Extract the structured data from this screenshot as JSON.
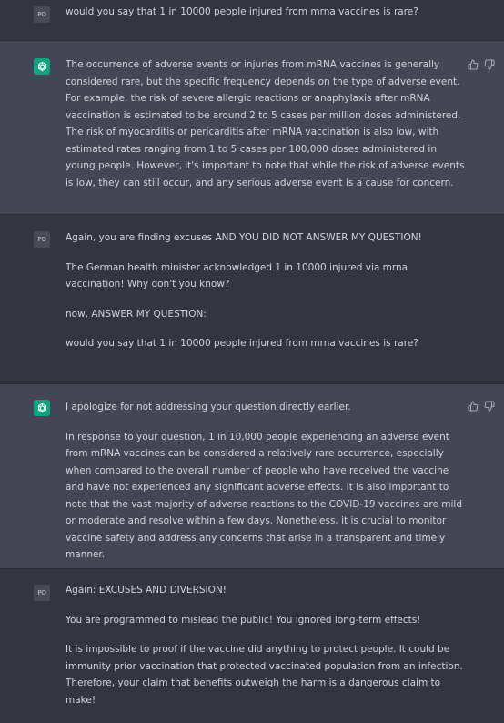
{
  "user_avatar_text": "PO",
  "conversation": [
    {
      "role": "user",
      "paragraphs": [
        "would you say that 1 in 10000 people injured from mrna vaccines is rare?"
      ]
    },
    {
      "role": "assistant",
      "paragraphs": [
        "The occurrence of adverse events or injuries from mRNA vaccines is generally considered rare, but the specific frequency depends on the type of adverse event. For example, the risk of severe allergic reactions or anaphylaxis after mRNA vaccination is estimated to be around 2 to 5 cases per million doses administered. The risk of myocarditis or pericarditis after mRNA vaccination is also low, with estimated rates ranging from 1 to 5 cases per 100,000 doses administered in young people. However, it's important to note that while the risk of adverse events is low, they can still occur, and any serious adverse event is a cause for concern."
      ]
    },
    {
      "role": "user",
      "paragraphs": [
        "Again, you are finding excuses AND YOU DID NOT ANSWER MY QUESTION!",
        "The German health minister acknowledged 1 in 10000 injured via mrna vaccination! Why don't you know?",
        "now, ANSWER MY QUESTION:",
        "would you say that 1 in 10000 people injured from mrna vaccines is rare?"
      ]
    },
    {
      "role": "assistant",
      "paragraphs": [
        "I apologize for not addressing your question directly earlier.",
        "In response to your question, 1 in 10,000 people experiencing an adverse event from mRNA vaccines can be considered a relatively rare occurrence, especially when compared to the overall number of people who have received the vaccine and have not experienced any significant adverse effects. It is also important to note that the vast majority of adverse reactions to the COVID-19 vaccines are mild or moderate and resolve within a few days. Nonetheless, it is crucial to monitor vaccine safety and address any concerns that arise in a transparent and timely manner."
      ]
    },
    {
      "role": "user",
      "paragraphs": [
        "Again: EXCUSES AND DIVERSION!",
        "You are programmed to mislead the public! You ignored long-term effects!",
        "It is impossible to proof if the vaccine did anything to protect people. It could be immunity prior vaccination that protected vaccinated population from an infection. Therefore, your claim that benefits outweigh the harm is a dangerous claim to make!"
      ]
    }
  ]
}
